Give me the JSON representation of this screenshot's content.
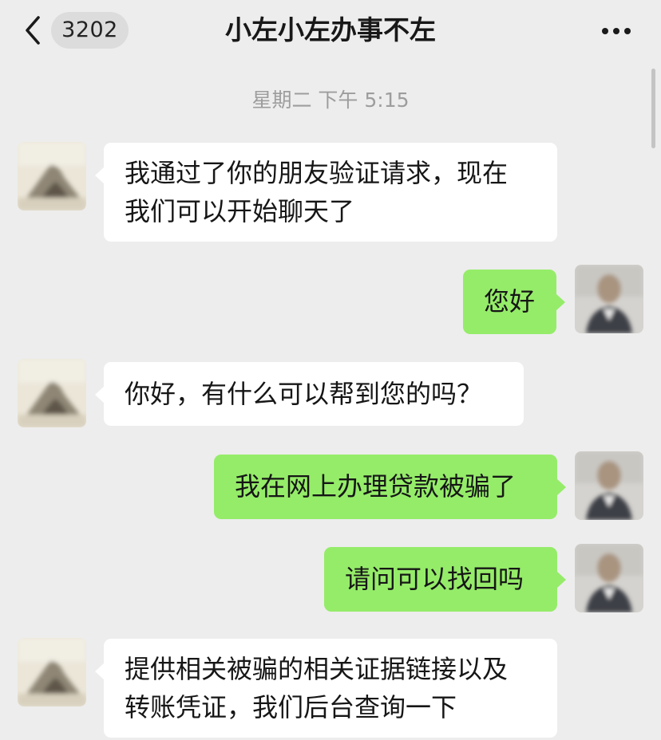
{
  "header": {
    "unread_count": "3202",
    "title": "小左小左办事不左",
    "back_icon": "chevron-left-icon",
    "more_icon": "more-dots-icon"
  },
  "timestamp": "星期二 下午 5:15",
  "colors": {
    "background": "#ededed",
    "incoming_bubble": "#ffffff",
    "outgoing_bubble": "#95ec69",
    "timestamp_text": "#9d9d9d"
  },
  "messages": [
    {
      "side": "left",
      "lines": [
        "我通过了你的朋友验证请求，现在",
        "我们可以开始聊天了"
      ]
    },
    {
      "side": "right",
      "lines": [
        "您好"
      ]
    },
    {
      "side": "left",
      "lines": [
        "你好，有什么可以帮到您的吗？"
      ]
    },
    {
      "side": "right",
      "lines": [
        "我在网上办理贷款被骗了"
      ]
    },
    {
      "side": "right",
      "lines": [
        "请问可以找回吗"
      ]
    },
    {
      "side": "left",
      "lines": [
        "提供相关被骗的相关证据链接以及",
        "转账凭证，我们后台查询一下"
      ]
    }
  ]
}
